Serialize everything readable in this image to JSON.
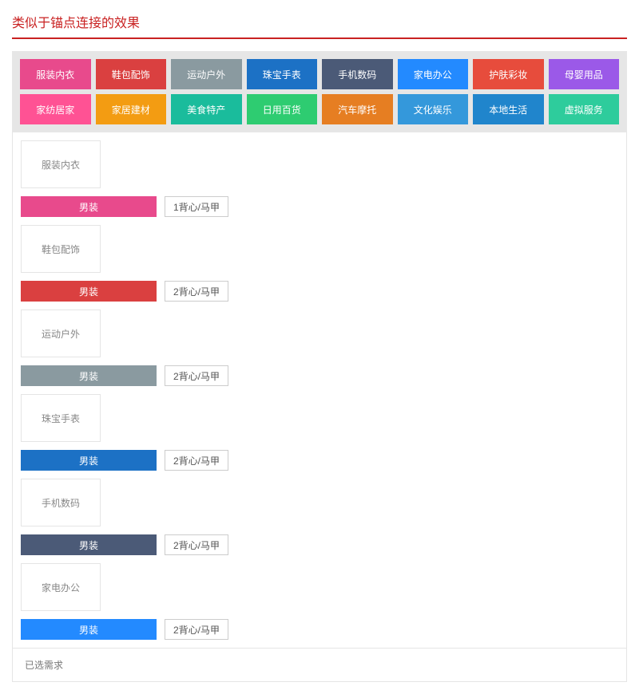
{
  "page_title": "类似于锚点连接的效果",
  "selected_label": "已选需求",
  "categories": [
    {
      "label": "服装内衣",
      "color_class": "c0"
    },
    {
      "label": "鞋包配饰",
      "color_class": "c1"
    },
    {
      "label": "运动户外",
      "color_class": "c2"
    },
    {
      "label": "珠宝手表",
      "color_class": "c3"
    },
    {
      "label": "手机数码",
      "color_class": "c4"
    },
    {
      "label": "家电办公",
      "color_class": "c5"
    },
    {
      "label": "护肤彩妆",
      "color_class": "c6"
    },
    {
      "label": "母婴用品",
      "color_class": "c7"
    },
    {
      "label": "家纺居家",
      "color_class": "c8"
    },
    {
      "label": "家居建材",
      "color_class": "c9"
    },
    {
      "label": "美食特产",
      "color_class": "c10"
    },
    {
      "label": "日用百货",
      "color_class": "c11"
    },
    {
      "label": "汽车摩托",
      "color_class": "c12"
    },
    {
      "label": "文化娱乐",
      "color_class": "c13"
    },
    {
      "label": "本地生活",
      "color_class": "c14"
    },
    {
      "label": "虚拟服务",
      "color_class": "c15"
    }
  ],
  "sections": [
    {
      "header": "服装内衣",
      "sub_label": "男装",
      "sub_color_class": "c0",
      "tag": "1背心/马甲"
    },
    {
      "header": "鞋包配饰",
      "sub_label": "男装",
      "sub_color_class": "c1",
      "tag": "2背心/马甲"
    },
    {
      "header": "运动户外",
      "sub_label": "男装",
      "sub_color_class": "c2",
      "tag": "2背心/马甲"
    },
    {
      "header": "珠宝手表",
      "sub_label": "男装",
      "sub_color_class": "c3",
      "tag": "2背心/马甲"
    },
    {
      "header": "手机数码",
      "sub_label": "男装",
      "sub_color_class": "c4",
      "tag": "2背心/马甲"
    },
    {
      "header": "家电办公",
      "sub_label": "男装",
      "sub_color_class": "c5",
      "tag": "2背心/马甲"
    }
  ]
}
